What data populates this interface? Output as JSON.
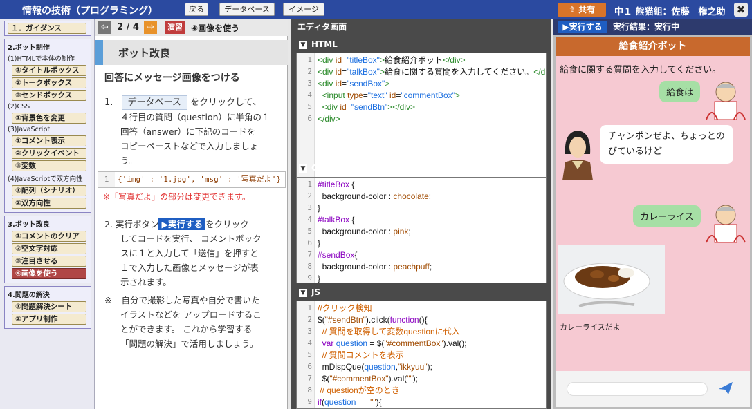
{
  "topbar": {
    "title": "情報の技術（プログラミング）",
    "back": "戻る",
    "database": "データベース",
    "image": "イメージ",
    "share": "共有",
    "user": "中１ 熊猫組：佐藤　権之助",
    "close": "✖"
  },
  "nav": {
    "guide": "１．ガイダンス",
    "sec2": "2.ボット制作",
    "sub_html": "(1)HTMLで本体の制作",
    "html_items": [
      "①タイトルボックス",
      "②トークボックス",
      "③センドボックス"
    ],
    "sub_css": "(2)CSS",
    "css_items": [
      "①背景色を変更"
    ],
    "sub_js": "(3)JavaScript",
    "js_items": [
      "①コメント表示",
      "②クリックイベント",
      "③変数"
    ],
    "sub_js2": "(4)JavaScriptで双方向性",
    "js2_items": [
      "①配列（シナリオ）",
      "②双方向性"
    ],
    "sec3": "3.ボット改良",
    "bot_items": [
      "①コメントのクリア",
      "②空文字対応",
      "③注目させる",
      "④画像を使う"
    ],
    "sec4": "4.問題の解決",
    "solve_items": [
      "①問題解決シート",
      "②アプリ制作"
    ]
  },
  "content": {
    "page": "2 / 4",
    "badge": "演習",
    "page_title": "④画像を使う",
    "heading": "ボット改良",
    "subheading": "回答にメッセージ画像をつける",
    "step1_num": "1.",
    "step1_btn": "データベース",
    "step1_rest": "をクリックして、",
    "step1_l2": "４行目の質問（question）に半角の１",
    "step1_l3": "回答（answer）に下記のコードを",
    "step1_l4": "コピーペーストなどで入力しましょ",
    "step1_l5": "う。",
    "code_no": "1",
    "code_text": "{'img' : '1.jpg', 'msg' : '写真だよ'}",
    "note": "※「写真だよ」の部分は変更できます。",
    "step2_num": "2.",
    "step2_pre": "実行ボタン",
    "step2_btn": "▶実行する",
    "step2_post": "をクリック",
    "step2_l2": "してコードを実行、 コメントボック",
    "step2_l3": "スに１と入力して「送信」を押すと",
    "step2_l4": "１で入力した画像とメッセージが表",
    "step2_l5": "示されます。",
    "note2_mark": "※",
    "note2_l1": "自分で撮影した写真や自分で書いた",
    "note2_l2": "イラストなどを アップロードするこ",
    "note2_l3": "とができます。 これから学習する",
    "note2_l4": "「問題の解決」で活用しましょう。"
  },
  "editor": {
    "title": "エディタ画面",
    "html_label": "HTML",
    "css_label": "CSS",
    "js_label": "JS"
  },
  "result": {
    "run": "▶実行する",
    "status": "実行結果：実行中",
    "bot_title": "給食紹介ボット",
    "intro": "給食に関する質問を入力してください。",
    "user1": "給食は",
    "bot1_l1": "チャンポンぜよ、ちょっとの",
    "bot1_l2": "びているけど",
    "user2": "カレーライス",
    "caption": "カレーライスだよ"
  },
  "colors": {
    "topbar": "#2b4aa0",
    "accent": "#c8692d",
    "chat_bg": "#f6c9d2",
    "user_bubble": "#a6dfa5",
    "active_nav": "#b04646"
  }
}
